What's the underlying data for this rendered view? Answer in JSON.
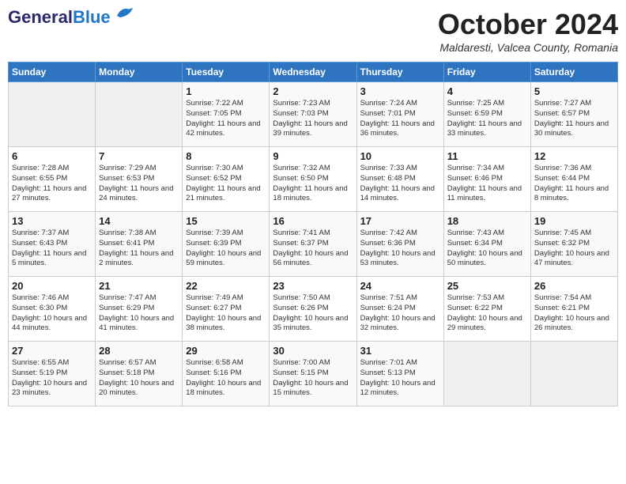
{
  "header": {
    "logo_line1": "General",
    "logo_line2": "Blue",
    "month_title": "October 2024",
    "location": "Maldaresti, Valcea County, Romania"
  },
  "weekdays": [
    "Sunday",
    "Monday",
    "Tuesday",
    "Wednesday",
    "Thursday",
    "Friday",
    "Saturday"
  ],
  "weeks": [
    [
      {
        "day": "",
        "sunrise": "",
        "sunset": "",
        "daylight": ""
      },
      {
        "day": "",
        "sunrise": "",
        "sunset": "",
        "daylight": ""
      },
      {
        "day": "1",
        "sunrise": "Sunrise: 7:22 AM",
        "sunset": "Sunset: 7:05 PM",
        "daylight": "Daylight: 11 hours and 42 minutes."
      },
      {
        "day": "2",
        "sunrise": "Sunrise: 7:23 AM",
        "sunset": "Sunset: 7:03 PM",
        "daylight": "Daylight: 11 hours and 39 minutes."
      },
      {
        "day": "3",
        "sunrise": "Sunrise: 7:24 AM",
        "sunset": "Sunset: 7:01 PM",
        "daylight": "Daylight: 11 hours and 36 minutes."
      },
      {
        "day": "4",
        "sunrise": "Sunrise: 7:25 AM",
        "sunset": "Sunset: 6:59 PM",
        "daylight": "Daylight: 11 hours and 33 minutes."
      },
      {
        "day": "5",
        "sunrise": "Sunrise: 7:27 AM",
        "sunset": "Sunset: 6:57 PM",
        "daylight": "Daylight: 11 hours and 30 minutes."
      }
    ],
    [
      {
        "day": "6",
        "sunrise": "Sunrise: 7:28 AM",
        "sunset": "Sunset: 6:55 PM",
        "daylight": "Daylight: 11 hours and 27 minutes."
      },
      {
        "day": "7",
        "sunrise": "Sunrise: 7:29 AM",
        "sunset": "Sunset: 6:53 PM",
        "daylight": "Daylight: 11 hours and 24 minutes."
      },
      {
        "day": "8",
        "sunrise": "Sunrise: 7:30 AM",
        "sunset": "Sunset: 6:52 PM",
        "daylight": "Daylight: 11 hours and 21 minutes."
      },
      {
        "day": "9",
        "sunrise": "Sunrise: 7:32 AM",
        "sunset": "Sunset: 6:50 PM",
        "daylight": "Daylight: 11 hours and 18 minutes."
      },
      {
        "day": "10",
        "sunrise": "Sunrise: 7:33 AM",
        "sunset": "Sunset: 6:48 PM",
        "daylight": "Daylight: 11 hours and 14 minutes."
      },
      {
        "day": "11",
        "sunrise": "Sunrise: 7:34 AM",
        "sunset": "Sunset: 6:46 PM",
        "daylight": "Daylight: 11 hours and 11 minutes."
      },
      {
        "day": "12",
        "sunrise": "Sunrise: 7:36 AM",
        "sunset": "Sunset: 6:44 PM",
        "daylight": "Daylight: 11 hours and 8 minutes."
      }
    ],
    [
      {
        "day": "13",
        "sunrise": "Sunrise: 7:37 AM",
        "sunset": "Sunset: 6:43 PM",
        "daylight": "Daylight: 11 hours and 5 minutes."
      },
      {
        "day": "14",
        "sunrise": "Sunrise: 7:38 AM",
        "sunset": "Sunset: 6:41 PM",
        "daylight": "Daylight: 11 hours and 2 minutes."
      },
      {
        "day": "15",
        "sunrise": "Sunrise: 7:39 AM",
        "sunset": "Sunset: 6:39 PM",
        "daylight": "Daylight: 10 hours and 59 minutes."
      },
      {
        "day": "16",
        "sunrise": "Sunrise: 7:41 AM",
        "sunset": "Sunset: 6:37 PM",
        "daylight": "Daylight: 10 hours and 56 minutes."
      },
      {
        "day": "17",
        "sunrise": "Sunrise: 7:42 AM",
        "sunset": "Sunset: 6:36 PM",
        "daylight": "Daylight: 10 hours and 53 minutes."
      },
      {
        "day": "18",
        "sunrise": "Sunrise: 7:43 AM",
        "sunset": "Sunset: 6:34 PM",
        "daylight": "Daylight: 10 hours and 50 minutes."
      },
      {
        "day": "19",
        "sunrise": "Sunrise: 7:45 AM",
        "sunset": "Sunset: 6:32 PM",
        "daylight": "Daylight: 10 hours and 47 minutes."
      }
    ],
    [
      {
        "day": "20",
        "sunrise": "Sunrise: 7:46 AM",
        "sunset": "Sunset: 6:30 PM",
        "daylight": "Daylight: 10 hours and 44 minutes."
      },
      {
        "day": "21",
        "sunrise": "Sunrise: 7:47 AM",
        "sunset": "Sunset: 6:29 PM",
        "daylight": "Daylight: 10 hours and 41 minutes."
      },
      {
        "day": "22",
        "sunrise": "Sunrise: 7:49 AM",
        "sunset": "Sunset: 6:27 PM",
        "daylight": "Daylight: 10 hours and 38 minutes."
      },
      {
        "day": "23",
        "sunrise": "Sunrise: 7:50 AM",
        "sunset": "Sunset: 6:26 PM",
        "daylight": "Daylight: 10 hours and 35 minutes."
      },
      {
        "day": "24",
        "sunrise": "Sunrise: 7:51 AM",
        "sunset": "Sunset: 6:24 PM",
        "daylight": "Daylight: 10 hours and 32 minutes."
      },
      {
        "day": "25",
        "sunrise": "Sunrise: 7:53 AM",
        "sunset": "Sunset: 6:22 PM",
        "daylight": "Daylight: 10 hours and 29 minutes."
      },
      {
        "day": "26",
        "sunrise": "Sunrise: 7:54 AM",
        "sunset": "Sunset: 6:21 PM",
        "daylight": "Daylight: 10 hours and 26 minutes."
      }
    ],
    [
      {
        "day": "27",
        "sunrise": "Sunrise: 6:55 AM",
        "sunset": "Sunset: 5:19 PM",
        "daylight": "Daylight: 10 hours and 23 minutes."
      },
      {
        "day": "28",
        "sunrise": "Sunrise: 6:57 AM",
        "sunset": "Sunset: 5:18 PM",
        "daylight": "Daylight: 10 hours and 20 minutes."
      },
      {
        "day": "29",
        "sunrise": "Sunrise: 6:58 AM",
        "sunset": "Sunset: 5:16 PM",
        "daylight": "Daylight: 10 hours and 18 minutes."
      },
      {
        "day": "30",
        "sunrise": "Sunrise: 7:00 AM",
        "sunset": "Sunset: 5:15 PM",
        "daylight": "Daylight: 10 hours and 15 minutes."
      },
      {
        "day": "31",
        "sunrise": "Sunrise: 7:01 AM",
        "sunset": "Sunset: 5:13 PM",
        "daylight": "Daylight: 10 hours and 12 minutes."
      },
      {
        "day": "",
        "sunrise": "",
        "sunset": "",
        "daylight": ""
      },
      {
        "day": "",
        "sunrise": "",
        "sunset": "",
        "daylight": ""
      }
    ]
  ]
}
